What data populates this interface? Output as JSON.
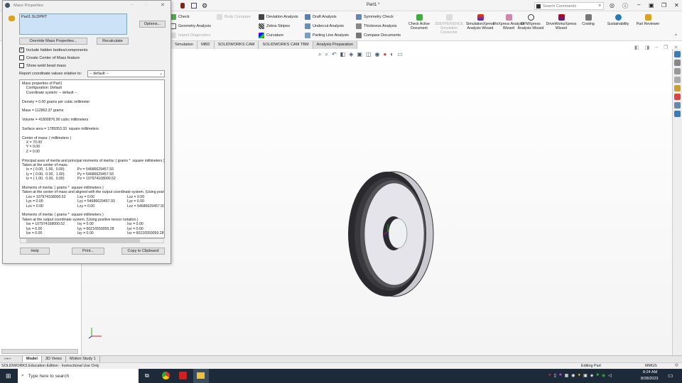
{
  "window": {
    "title": "Part1 *",
    "search_placeholder": "Search Commands"
  },
  "ribbon": {
    "small": [
      "Check",
      "Geometry Analysis",
      "Import Diagnostics",
      "Body Compare",
      "Deviation Analysis",
      "Zebra Stripes",
      "Curvature",
      "Draft Analysis",
      "Undercut Analysis",
      "Parting Line Analysis",
      "Symmetry Check",
      "Thickness Analysis",
      "Compare Documents"
    ],
    "big": [
      "Check Active Document",
      "3DEXPERIENCE Simulation Connector",
      "SimulationXpress Analysis Wizard",
      "FloXpress Analysis Wizard",
      "DFMXpress Analysis Wizard",
      "DriveWorksXpress Wizard",
      "Costing",
      "Sustainability",
      "Part Reviewer"
    ]
  },
  "tabs": [
    "Simulation",
    "MBD",
    "SOLIDWORKS CAM",
    "SOLIDWORKS CAM TBM",
    "Analysis Preparation"
  ],
  "dialog": {
    "title": "Mass Properties",
    "selection": "Part1.SLDPRT",
    "options": "Options...",
    "override": "Override Mass Properties...",
    "recalc": "Recalculate",
    "chk_hidden": "Include hidden bodies/components",
    "chk_com": "Create Center of Mass feature",
    "chk_weld": "Show weld bead mass",
    "report_label": "Report coordinate values relative to:",
    "coord_value": "-- default --",
    "help": "Help",
    "print": "Print...",
    "copy": "Copy to Clipboard",
    "report": [
      [
        "Mass properties of Part1"
      ],
      [
        "    Configuration: Default"
      ],
      [
        "    Coordinate system: -- default --"
      ],
      [
        ""
      ],
      [
        "Density = 0.00 grams per cubic millimeter"
      ],
      [
        ""
      ],
      [
        "Mass = 112862.37 grams"
      ],
      [
        ""
      ],
      [
        "Volume = 41800876.90 cubic millimeters"
      ],
      [
        ""
      ],
      [
        "Surface area = 1789353.33  square millimeters"
      ],
      [
        ""
      ],
      [
        "Center of mass: ( millimeters )"
      ],
      [
        "    X = 70.00"
      ],
      [
        "    Y = 0.00"
      ],
      [
        "    Z = 0.00"
      ],
      [
        ""
      ],
      [
        "Principal axes of inertia and principal moments of inertia: ( grams *  square millimeters )"
      ],
      [
        "Taken at the center of mass."
      ],
      [
        "    Ix = ( 0.00,  1.00,  0.00)",
        "Px = 54686629457.93"
      ],
      [
        "    Iy = ( 0.00,  0.00,  1.00)",
        "Py = 54686629457.93"
      ],
      [
        "    Iz = ( 1.00,  0.00,  0.00)",
        "Pz = 107974168000.52"
      ],
      [
        ""
      ],
      [
        "Moments of inertia: ( grams *  square millimeters )"
      ],
      [
        "Taken at the center of mass and aligned with the output coordinate system. (Using positive tensor notation.)"
      ],
      [
        "    Lxx = 107974168000.52",
        "Lxy = 0.00",
        "Lxz = 0.00"
      ],
      [
        "    Lyx = 0.00",
        "Lyy = 54686629457.93",
        "Lyz = 0.00"
      ],
      [
        "    Lzx = 0.00",
        "Lzy = 0.00",
        "Lzz = 54686629457.93"
      ],
      [
        ""
      ],
      [
        "Moments of inertia: ( grams *  square millimeters )"
      ],
      [
        "Taken at the output coordinate system. (Using positive tensor notation.)"
      ],
      [
        "    Ixx = 107974168000.52",
        "Ixy = 0.00",
        "Ixz = 0.00"
      ],
      [
        "    Iyx = 0.00",
        "Iyy = 60216550059.28",
        "Iyz = 0.00"
      ],
      [
        "    Izx = 0.00",
        "Izy = 0.00",
        "Izz = 60216550059.28"
      ]
    ]
  },
  "bottom_tabs": [
    "Model",
    "3D Views",
    "Motion Study 1"
  ],
  "status": {
    "left": "SOLIDWORKS Education Edition - Instructional Use Only",
    "mode": "Editing Part",
    "units": "MMGS"
  },
  "taskbar": {
    "search": "Type here to search",
    "time": "8:24 AM",
    "date": "8/28/2023"
  }
}
